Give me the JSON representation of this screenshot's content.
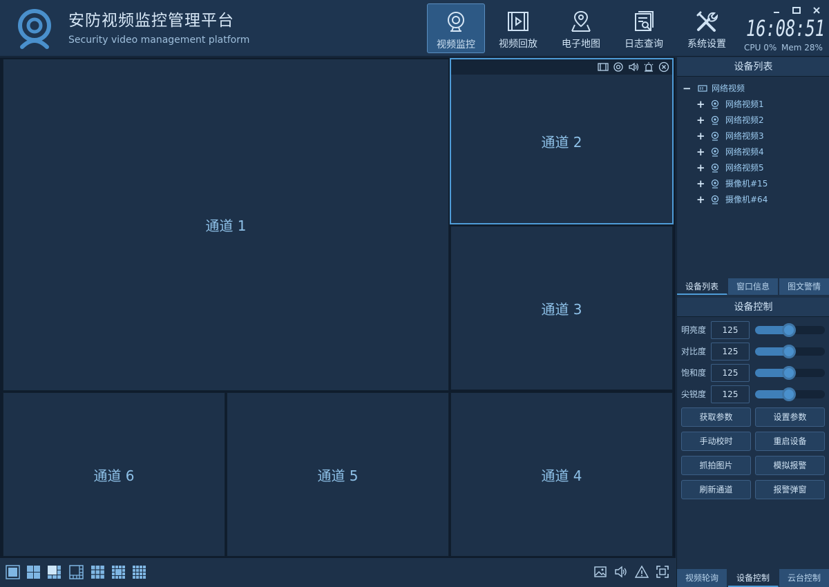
{
  "header": {
    "title": "安防视频监控管理平台",
    "subtitle": "Security video management platform",
    "nav": [
      {
        "label": "视频监控",
        "icon": "webcam-icon",
        "active": true
      },
      {
        "label": "视频回放",
        "icon": "film-play-icon",
        "active": false
      },
      {
        "label": "电子地图",
        "icon": "map-pin-icon",
        "active": false
      },
      {
        "label": "日志查询",
        "icon": "log-search-icon",
        "active": false
      },
      {
        "label": "系统设置",
        "icon": "tools-icon",
        "active": false
      }
    ],
    "clock": "16:08:51",
    "cpu": "CPU 0%",
    "mem": "Mem 28%"
  },
  "channels": [
    {
      "label": "通道 1"
    },
    {
      "label": "通道 2"
    },
    {
      "label": "通道 3"
    },
    {
      "label": "通道 4"
    },
    {
      "label": "通道 5"
    },
    {
      "label": "通道 6"
    }
  ],
  "device_list": {
    "title": "设备列表",
    "root": "网络视频",
    "items": [
      "网络视频1",
      "网络视频2",
      "网络视频3",
      "网络视频4",
      "网络视频5",
      "摄像机#15",
      "摄像机#64"
    ]
  },
  "upper_tabs": [
    {
      "label": "设备列表",
      "active": true
    },
    {
      "label": "窗口信息",
      "active": false
    },
    {
      "label": "图文警情",
      "active": false
    }
  ],
  "device_control": {
    "title": "设备控制",
    "params": [
      {
        "label": "明亮度",
        "value": "125",
        "level": 0.49
      },
      {
        "label": "对比度",
        "value": "125",
        "level": 0.49
      },
      {
        "label": "饱和度",
        "value": "125",
        "level": 0.49
      },
      {
        "label": "尖锐度",
        "value": "125",
        "level": 0.49
      }
    ],
    "buttons": [
      "获取参数",
      "设置参数",
      "手动校时",
      "重启设备",
      "抓拍图片",
      "模拟报警",
      "刷新通道",
      "报警弹窗"
    ]
  },
  "lower_tabs": [
    {
      "label": "视频轮询",
      "active": false
    },
    {
      "label": "设备控制",
      "active": true
    },
    {
      "label": "云台控制",
      "active": false
    }
  ],
  "colors": {
    "background": "#1d3149",
    "accent": "#4f9cd8",
    "channel_text": "#8ec1e8",
    "nav_active": "#2d5985"
  }
}
